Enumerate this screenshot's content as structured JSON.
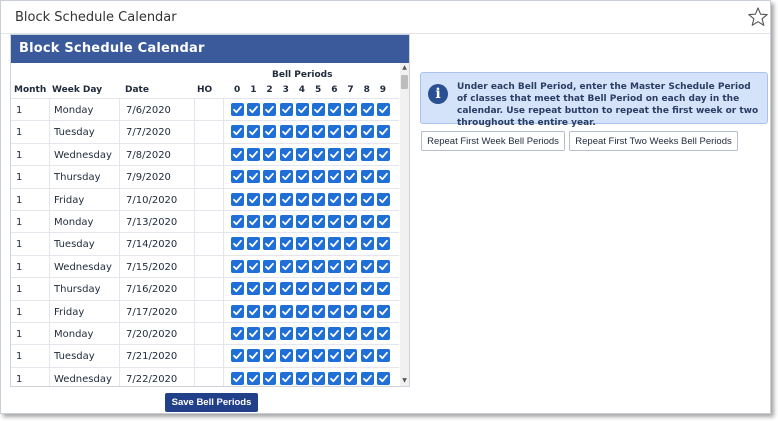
{
  "window": {
    "title": "Block Schedule Calendar"
  },
  "panel": {
    "header": "Block Schedule Calendar"
  },
  "columns": {
    "month": "Month",
    "weekday": "Week Day",
    "date": "Date",
    "ho": "HO",
    "bell_periods": "Bell Periods",
    "periods": [
      "0",
      "1",
      "2",
      "3",
      "4",
      "5",
      "6",
      "7",
      "8",
      "9"
    ]
  },
  "rows": [
    {
      "month": "1",
      "weekday": "Monday",
      "date": "7/6/2020"
    },
    {
      "month": "1",
      "weekday": "Tuesday",
      "date": "7/7/2020"
    },
    {
      "month": "1",
      "weekday": "Wednesday",
      "date": "7/8/2020"
    },
    {
      "month": "1",
      "weekday": "Thursday",
      "date": "7/9/2020"
    },
    {
      "month": "1",
      "weekday": "Friday",
      "date": "7/10/2020"
    },
    {
      "month": "1",
      "weekday": "Monday",
      "date": "7/13/2020"
    },
    {
      "month": "1",
      "weekday": "Tuesday",
      "date": "7/14/2020"
    },
    {
      "month": "1",
      "weekday": "Wednesday",
      "date": "7/15/2020"
    },
    {
      "month": "1",
      "weekday": "Thursday",
      "date": "7/16/2020"
    },
    {
      "month": "1",
      "weekday": "Friday",
      "date": "7/17/2020"
    },
    {
      "month": "1",
      "weekday": "Monday",
      "date": "7/20/2020"
    },
    {
      "month": "1",
      "weekday": "Tuesday",
      "date": "7/21/2020"
    },
    {
      "month": "1",
      "weekday": "Wednesday",
      "date": "7/22/2020"
    }
  ],
  "all_periods_checked": true,
  "info": {
    "icon": "info-icon",
    "message": "Under each Bell Period, enter the Master Schedule Period of classes that meet that Bell Period on each day in the calendar. Use repeat button to repeat the first week or two throughout the entire year."
  },
  "buttons": {
    "repeat_first_week": "Repeat First Week Bell Periods",
    "repeat_first_two_weeks": "Repeat First Two Weeks Bell Periods",
    "save": "Save Bell Periods"
  },
  "colors": {
    "header_bg": "#3a5a9b",
    "checkbox": "#1f6fd6",
    "save_button": "#22408a",
    "info_bg": "#d5e3fa"
  }
}
